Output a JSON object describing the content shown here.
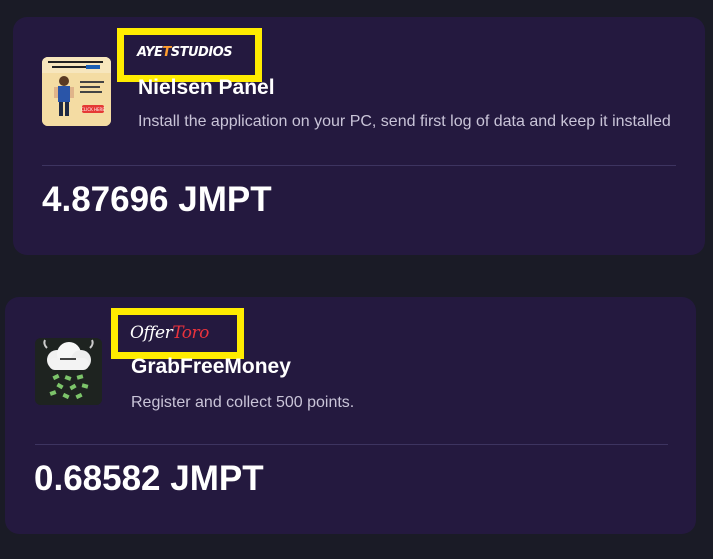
{
  "offers": [
    {
      "provider": "AYET STUDIOS",
      "provider_logo_parts": [
        "AYE",
        "T",
        "STUDIOS"
      ],
      "thumbnail_icon": "paypal-rewards-ad-thumbnail",
      "thumbnail_text": {
        "headline": "Get cash rewards straight to your PayPal account!",
        "cta": "CLICK HERE"
      },
      "title": "Nielsen Panel",
      "description": "Install the application on your PC, send first log of data and keep it installed",
      "reward": "4.87696 JMPT"
    },
    {
      "provider": "OfferToro",
      "provider_logo_parts": [
        "Offer",
        "Toro"
      ],
      "thumbnail_icon": "money-cloud-icon",
      "title": "GrabFreeMoney",
      "description": "Register and collect 500 points.",
      "reward": "0.68582 JMPT"
    }
  ],
  "colors": {
    "background": "#1a1b26",
    "card": "#24193f",
    "highlight_box": "#ffec00",
    "text_primary": "#ffffff",
    "text_secondary": "#c9c4d8"
  }
}
